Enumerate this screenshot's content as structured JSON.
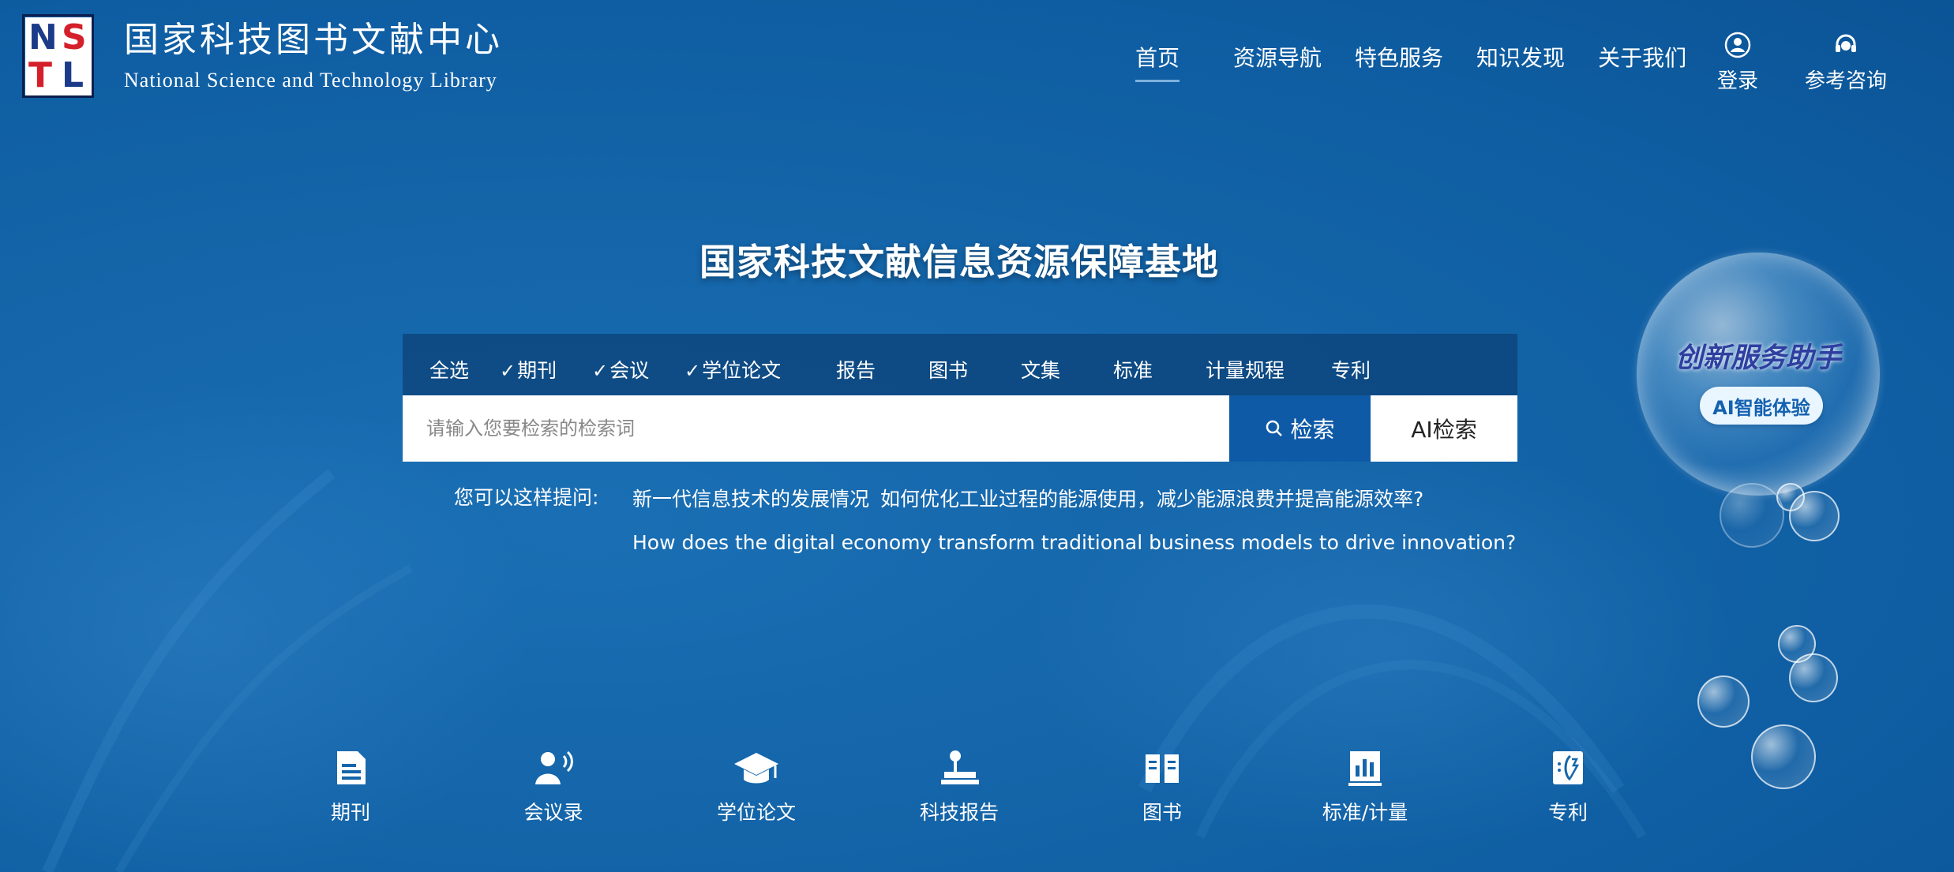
{
  "brand": {
    "logo_letters": [
      "N",
      "S",
      "T",
      "L"
    ],
    "name_cn": "国家科技图书文献中心",
    "name_en": "National Science and Technology Library"
  },
  "nav": {
    "items": [
      "首页",
      "资源导航",
      "特色服务",
      "知识发现",
      "关于我们"
    ],
    "active": "首页",
    "login": {
      "label": "登录",
      "icon": "user-icon"
    },
    "consult": {
      "label": "参考咨询",
      "icon": "headset-icon"
    }
  },
  "hero": {
    "title": "国家科技文献信息资源保障基地"
  },
  "search": {
    "tabs": [
      {
        "label": "全选",
        "checked": false
      },
      {
        "label": "期刊",
        "checked": true
      },
      {
        "label": "会议",
        "checked": true
      },
      {
        "label": "学位论文",
        "checked": true
      },
      {
        "label": "报告",
        "checked": false
      },
      {
        "label": "图书",
        "checked": false
      },
      {
        "label": "文集",
        "checked": false
      },
      {
        "label": "标准",
        "checked": false
      },
      {
        "label": "计量规程",
        "checked": false
      },
      {
        "label": "专利",
        "checked": false
      }
    ],
    "check_glyph": "✓",
    "placeholder": "请输入您要检索的检索词",
    "search_label": "检索",
    "ai_search_label": "AI检索"
  },
  "hints": {
    "label": "您可以这样提问:",
    "items": [
      "新一代信息技术的发展情况",
      "如何优化工业过程的能源使用，减少能源浪费并提高能源效率?",
      "How does the digital economy transform traditional business models to drive innovation?"
    ]
  },
  "assistant": {
    "title": "创新服务助手",
    "badge": "AI智能体验"
  },
  "categories": [
    {
      "label": "期刊",
      "icon": "journal-icon"
    },
    {
      "label": "会议录",
      "icon": "conference-icon"
    },
    {
      "label": "学位论文",
      "icon": "graduation-cap-icon"
    },
    {
      "label": "科技报告",
      "icon": "report-icon"
    },
    {
      "label": "图书",
      "icon": "book-icon"
    },
    {
      "label": "标准/计量",
      "icon": "standard-chart-icon"
    },
    {
      "label": "专利",
      "icon": "patent-icon"
    }
  ],
  "colors": {
    "background": "#1566aa",
    "search_button": "#0e5aa7",
    "tab_bar": "#0a3c6e",
    "assistant_title": "#2e3fa0"
  }
}
